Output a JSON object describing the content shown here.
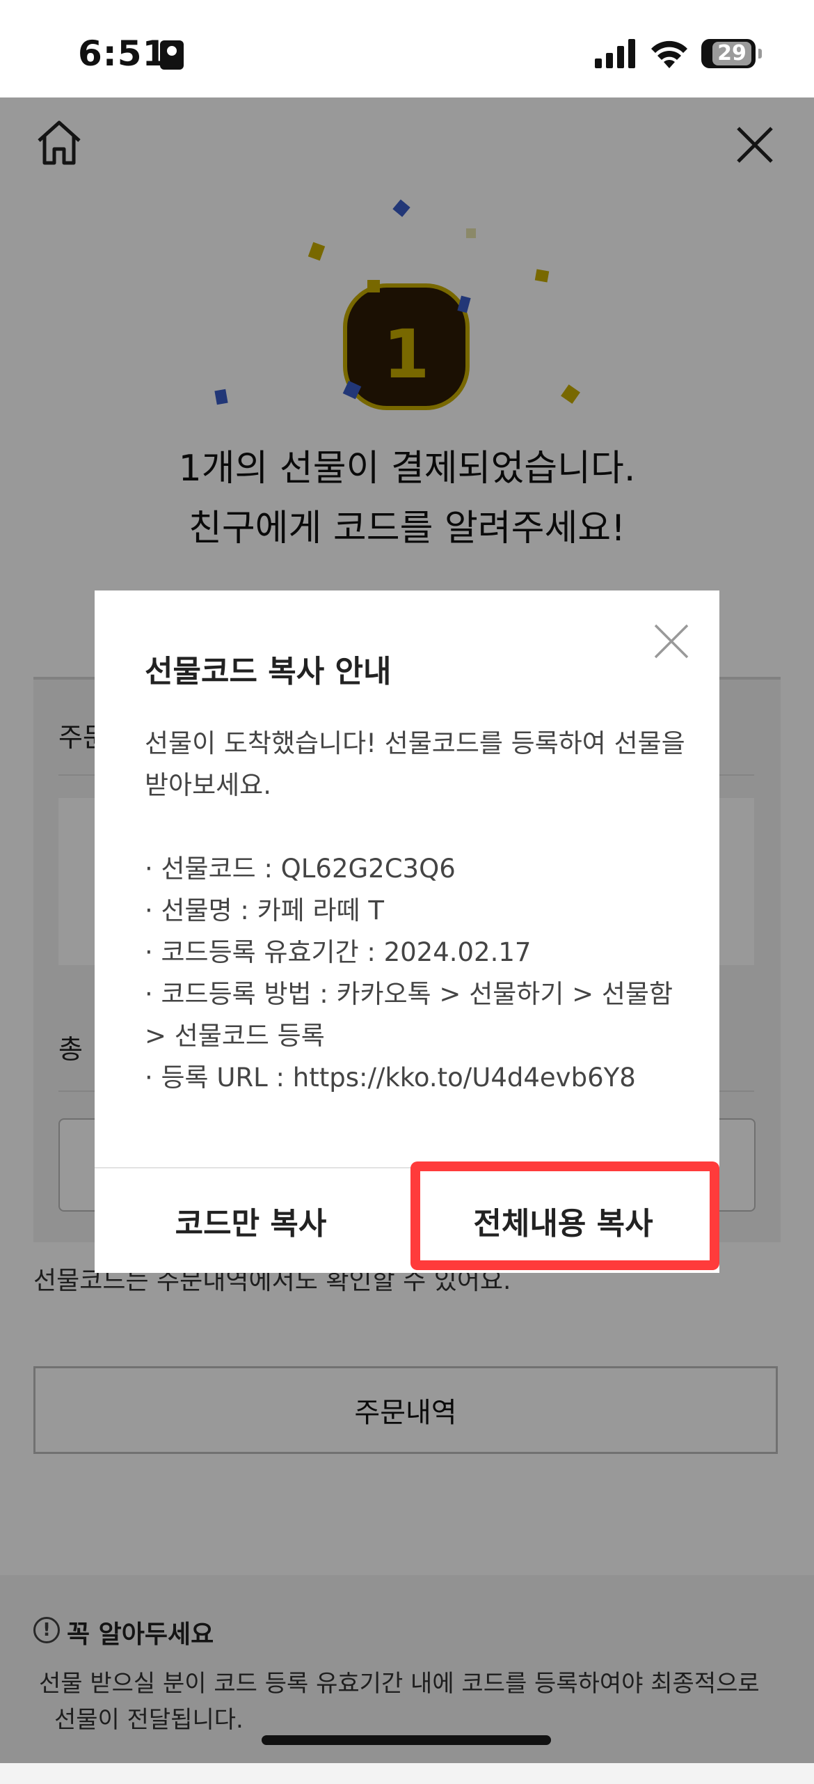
{
  "status_bar": {
    "time": "6:51",
    "battery": "29"
  },
  "page": {
    "headline_line1": "1개의 선물이 결제되었습니다.",
    "headline_line2": "친구에게 코드를 알려주세요!",
    "badge_number": "1",
    "order_label": "주문",
    "total_label": "총",
    "footer_note": "선물코드는 주문내역에서도 확인할 수 있어요.",
    "order_history_button": "주문내역",
    "notice": {
      "title": "꼭 알아두세요",
      "line1": "선물 받으실 분이 코드 등록 유효기간 내에 코드를 등록하여야 최종적으로",
      "line2": "선물이 전달됩니다."
    }
  },
  "modal": {
    "title": "선물코드 복사 안내",
    "message": "선물이 도착했습니다! 선물코드를 등록하여 선물을 받아보세요.",
    "items": [
      "· 선물코드 : QL62G2C3Q6",
      "· 선물명 : 카페 라떼 T",
      "· 코드등록 유효기간 : 2024.02.17",
      "· 코드등록 방법 : 카카오톡 > 선물하기 > 선물함 > 선물코드 등록",
      "· 등록 URL : https://kko.to/U4d4evb6Y8"
    ],
    "copy_code_button": "코드만 복사",
    "copy_all_button": "전체내용 복사"
  },
  "colors": {
    "highlight": "#ff3b3b",
    "badge_bg": "#2d1b05",
    "badge_text": "#c9a800",
    "confetti_yellow": "#c9ad00",
    "confetti_blue": "#3a5cc7"
  }
}
